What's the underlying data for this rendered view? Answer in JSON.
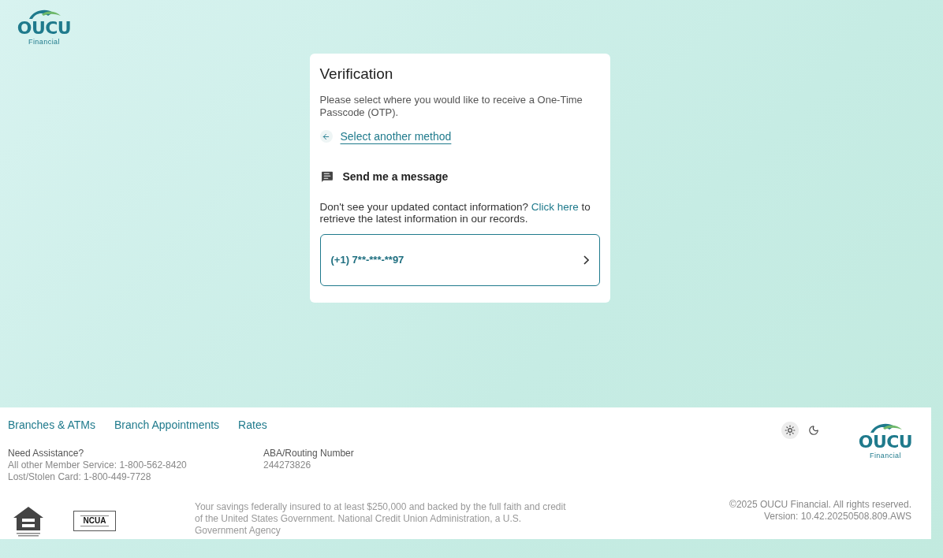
{
  "logo": {
    "name": "OUCU",
    "subtitle": "Financial"
  },
  "card": {
    "title": "Verification",
    "intro": "Please select where you would like to receive a One-Time Passcode (OTP).",
    "back_link": "Select another method",
    "method_heading": "Send me a message",
    "notice_before": "Don't see your updated contact information?",
    "notice_link": "Click here",
    "notice_after": "to retrieve the latest information in our records.",
    "phone_option": "(+1) 7**-***-**97"
  },
  "footer": {
    "links": [
      "Branches & ATMs",
      "Branch Appointments",
      "Rates"
    ],
    "assistance": {
      "heading": "Need Assistance?",
      "lines": [
        "All other Member Service: 1-800-562-8420",
        "Lost/Stolen Card: 1-800-449-7728"
      ]
    },
    "routing": {
      "heading": "ABA/Routing Number",
      "number": "244273826"
    },
    "theme_options": [
      {
        "kind": "light",
        "selected": true
      },
      {
        "kind": "dark",
        "selected": false
      }
    ],
    "logo": {
      "name": "OUCU",
      "subtitle": "Financial"
    },
    "ncua_label": "NCUA",
    "disclaimer": "Your savings federally insured to at least $250,000 and backed by the full faith and credit of the United States Government. National Credit Union Administration, a U.S. Government Agency",
    "copyright": "©2025 OUCU Financial. All rights reserved.",
    "version": "Version: 10.42.20250508.809.AWS"
  }
}
